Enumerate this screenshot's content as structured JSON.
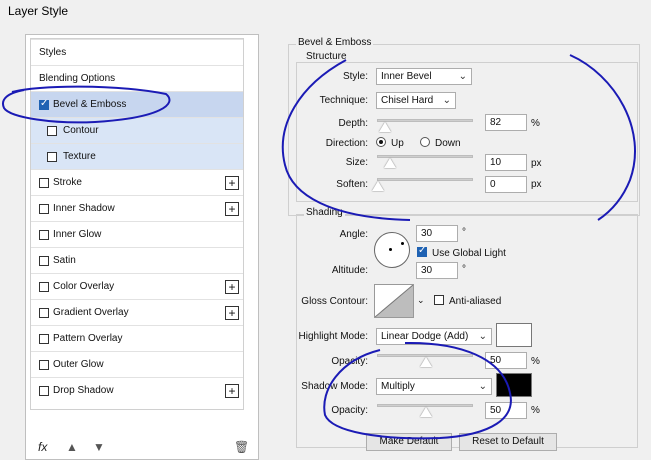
{
  "window": {
    "title": "Layer Style"
  },
  "left": {
    "items": [
      {
        "label": "Styles",
        "has_checkbox": false,
        "checked": false,
        "plus": false
      },
      {
        "label": "Blending Options",
        "has_checkbox": false,
        "checked": false,
        "plus": false
      },
      {
        "label": "Bevel & Emboss",
        "has_checkbox": true,
        "checked": true,
        "plus": false,
        "selected": true
      },
      {
        "label": "Contour",
        "has_checkbox": true,
        "checked": false,
        "plus": false,
        "sub": true
      },
      {
        "label": "Texture",
        "has_checkbox": true,
        "checked": false,
        "plus": false,
        "sub": true
      },
      {
        "label": "Stroke",
        "has_checkbox": true,
        "checked": false,
        "plus": true
      },
      {
        "label": "Inner Shadow",
        "has_checkbox": true,
        "checked": false,
        "plus": true
      },
      {
        "label": "Inner Glow",
        "has_checkbox": true,
        "checked": false,
        "plus": false
      },
      {
        "label": "Satin",
        "has_checkbox": true,
        "checked": false,
        "plus": false
      },
      {
        "label": "Color Overlay",
        "has_checkbox": true,
        "checked": false,
        "plus": true
      },
      {
        "label": "Gradient Overlay",
        "has_checkbox": true,
        "checked": false,
        "plus": true
      },
      {
        "label": "Pattern Overlay",
        "has_checkbox": true,
        "checked": false,
        "plus": false
      },
      {
        "label": "Outer Glow",
        "has_checkbox": true,
        "checked": false,
        "plus": false
      },
      {
        "label": "Drop Shadow",
        "has_checkbox": true,
        "checked": false,
        "plus": true
      }
    ],
    "bottom": {
      "fx": "fx",
      "up": "▲",
      "down": "▼",
      "trash": "🗑"
    },
    "plus_sign": "+"
  },
  "right": {
    "bevel_title": "Bevel & Emboss",
    "structure_title": "Structure",
    "style_label": "Style:",
    "style_value": "Inner Bevel",
    "technique_label": "Technique:",
    "technique_value": "Chisel Hard",
    "depth_label": "Depth:",
    "depth_value": "82",
    "depth_unit": "%",
    "direction_label": "Direction:",
    "direction_up": "Up",
    "direction_down": "Down",
    "size_label": "Size:",
    "size_value": "10",
    "size_unit": "px",
    "soften_label": "Soften:",
    "soften_value": "0",
    "soften_unit": "px",
    "shading_title": "Shading",
    "angle_label": "Angle:",
    "angle_value": "30",
    "angle_unit": "°",
    "use_global_light": "Use Global Light",
    "altitude_label": "Altitude:",
    "altitude_value": "30",
    "altitude_unit": "°",
    "gloss_contour_label": "Gloss Contour:",
    "anti_aliased": "Anti-aliased",
    "highlight_mode_label": "Highlight Mode:",
    "highlight_mode_value": "Linear Dodge (Add)",
    "highlight_opacity_label": "Opacity:",
    "highlight_opacity_value": "50",
    "highlight_opacity_unit": "%",
    "shadow_mode_label": "Shadow Mode:",
    "shadow_mode_value": "Multiply",
    "shadow_opacity_label": "Opacity:",
    "shadow_opacity_value": "50",
    "shadow_opacity_unit": "%",
    "make_default": "Make Default",
    "reset_default": "Reset to Default",
    "caret": "⌄"
  },
  "colors": {
    "highlight_color": "#ffffff",
    "shadow_color": "#000000",
    "annotation": "#1b1bb5",
    "selection": "#c7d6ef"
  }
}
